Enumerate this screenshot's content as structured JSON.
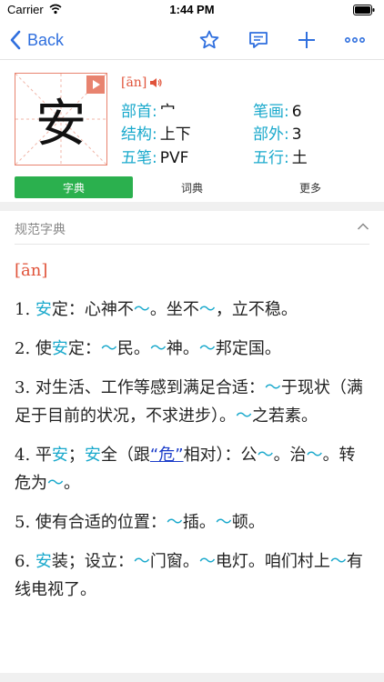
{
  "status_bar": {
    "carrier": "Carrier",
    "time": "1:44 PM"
  },
  "nav": {
    "back_label": "Back"
  },
  "character": {
    "glyph": "安",
    "pinyin": "[ān]",
    "radical_label": "部首:",
    "radical_value": "宀",
    "strokes_label": "笔画:",
    "strokes_value": "6",
    "structure_label": "结构:",
    "structure_value": "上下",
    "outside_label": "部外:",
    "outside_value": "3",
    "wubi_label": "五笔:",
    "wubi_value": "PVF",
    "element_label": "五行:",
    "element_value": "土"
  },
  "tabs": [
    {
      "label": "字典",
      "active": true
    },
    {
      "label": "词典",
      "active": false
    },
    {
      "label": "更多",
      "active": false
    }
  ],
  "section": {
    "title": "规范字典"
  },
  "entry": {
    "pinyin": "[ān]",
    "defs": [
      {
        "num": "1.",
        "parts": [
          {
            "t": "安",
            "c": "hl"
          },
          {
            "t": "定：心神不"
          },
          {
            "t": "～",
            "c": "hl"
          },
          {
            "t": "。坐不"
          },
          {
            "t": "～",
            "c": "hl"
          },
          {
            "t": "，立不稳。"
          }
        ]
      },
      {
        "num": "2.",
        "parts": [
          {
            "t": "使"
          },
          {
            "t": "安",
            "c": "hl"
          },
          {
            "t": "定："
          },
          {
            "t": "～",
            "c": "hl"
          },
          {
            "t": "民。"
          },
          {
            "t": "～",
            "c": "hl"
          },
          {
            "t": "神。"
          },
          {
            "t": "～",
            "c": "hl"
          },
          {
            "t": "邦定国。"
          }
        ]
      },
      {
        "num": "3.",
        "parts": [
          {
            "t": "对生活、工作等感到满足合适："
          },
          {
            "t": "～",
            "c": "hl"
          },
          {
            "t": "于现状（满足于目前的状况，不求进步）。"
          },
          {
            "t": "～",
            "c": "hl"
          },
          {
            "t": "之若素。"
          }
        ]
      },
      {
        "num": "4.",
        "parts": [
          {
            "t": "平"
          },
          {
            "t": "安",
            "c": "hl"
          },
          {
            "t": "；"
          },
          {
            "t": "安",
            "c": "hl"
          },
          {
            "t": "全（跟"
          },
          {
            "t": "“危”",
            "c": "link"
          },
          {
            "t": "相对）：公"
          },
          {
            "t": "～",
            "c": "hl"
          },
          {
            "t": "。治"
          },
          {
            "t": "～",
            "c": "hl"
          },
          {
            "t": "。转危为"
          },
          {
            "t": "～",
            "c": "hl"
          },
          {
            "t": "。"
          }
        ]
      },
      {
        "num": "5.",
        "parts": [
          {
            "t": "使有合适的位置："
          },
          {
            "t": "～",
            "c": "hl"
          },
          {
            "t": "插。"
          },
          {
            "t": "～",
            "c": "hl"
          },
          {
            "t": "顿。"
          }
        ]
      },
      {
        "num": "6.",
        "parts": [
          {
            "t": "安",
            "c": "hl"
          },
          {
            "t": "装；设立："
          },
          {
            "t": "～",
            "c": "hl"
          },
          {
            "t": "门窗。"
          },
          {
            "t": "～",
            "c": "hl"
          },
          {
            "t": "电灯。咱们村上"
          },
          {
            "t": "～",
            "c": "hl"
          },
          {
            "t": "有线电视了。"
          }
        ]
      }
    ]
  },
  "colors": {
    "accent_blue": "#2f6fde",
    "cyan": "#1aa9cc",
    "green": "#2bb04e",
    "red": "#e0533a",
    "box": "#e8836f"
  },
  "icons": [
    "wifi-icon",
    "battery-icon",
    "chevron-left-icon",
    "star-icon",
    "comment-icon",
    "plus-icon",
    "more-icon",
    "play-icon",
    "speaker-icon",
    "chevron-up-icon"
  ]
}
